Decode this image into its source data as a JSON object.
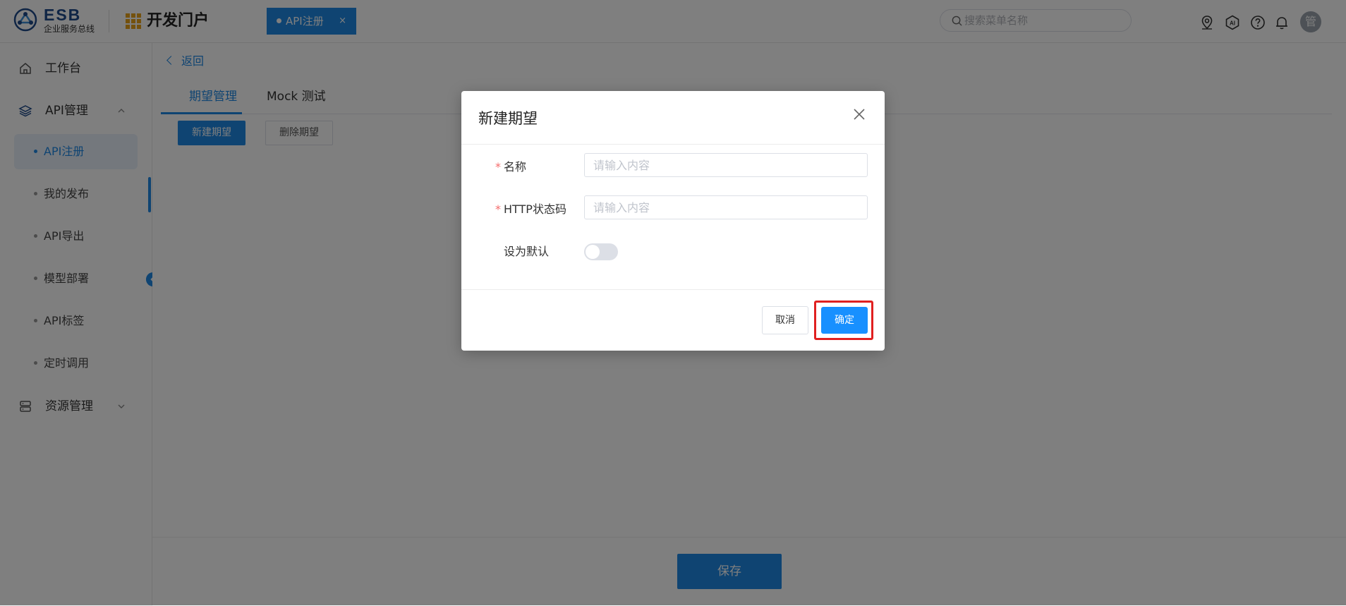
{
  "header": {
    "logo_text": "ESB",
    "logo_sub": "企业服务总线",
    "portal_title": "开发门户",
    "tab_label": "API注册",
    "tab_close": "×",
    "search_placeholder": "搜索菜单名称",
    "icons": [
      "location-icon",
      "ai-icon",
      "help-icon",
      "bell-icon"
    ],
    "avatar_text": "管"
  },
  "sidebar": {
    "workbench": "工作台",
    "api_manage": "API管理",
    "sub_items": [
      "API注册",
      "我的发布",
      "API导出",
      "模型部署",
      "API标签",
      "定时调用"
    ],
    "resource_manage": "资源管理"
  },
  "main": {
    "back_label": "返回",
    "tabs": [
      "期望管理",
      "Mock 测试"
    ],
    "new_expect": "新建期望",
    "delete_expect": "删除期望",
    "save": "保存"
  },
  "dialog": {
    "title": "新建期望",
    "fields": [
      {
        "label": "名称",
        "placeholder": "请输入内容",
        "required": true
      },
      {
        "label": "HTTP状态码",
        "placeholder": "请输入内容",
        "required": true
      }
    ],
    "default_label": "设为默认",
    "default_value": false,
    "cancel": "取消",
    "confirm": "确定"
  },
  "colors": {
    "primary": "#1e88e5",
    "highlight": "#e02020",
    "required": "#f56c6c"
  }
}
